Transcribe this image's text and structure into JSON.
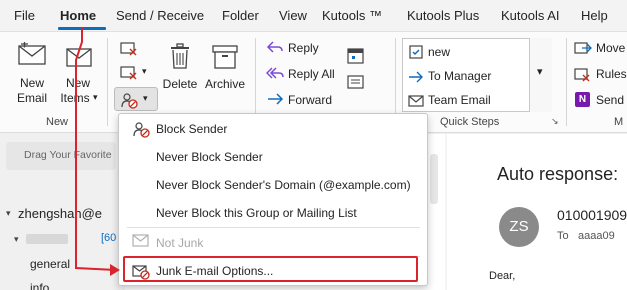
{
  "menubar": {
    "items": [
      "File",
      "Home",
      "Send / Receive",
      "Folder",
      "View",
      "Kutools ™",
      "Kutools Plus",
      "Kutools AI",
      "Help"
    ],
    "active": "Home"
  },
  "ribbon": {
    "new_group": {
      "new_email": [
        "New",
        "Email"
      ],
      "new_items": [
        "New",
        "Items"
      ],
      "label": "New"
    },
    "delete_group": {
      "delete": "Delete",
      "archive": "Archive"
    },
    "respond_group": {
      "reply": "Reply",
      "reply_all": "Reply All",
      "forward": "Forward"
    },
    "quick_steps": {
      "items": [
        "new",
        "To Manager",
        "Team Email"
      ],
      "label": "Quick Steps"
    },
    "move_group": {
      "items": [
        "Move",
        "Rules",
        "Send t"
      ],
      "label": "M"
    }
  },
  "left_pane": {
    "drag_hint": "Drag Your Favorite",
    "account": "zhengshan@e",
    "count": "[60",
    "folders": [
      "general",
      "info"
    ]
  },
  "reading_pane": {
    "subject": "Auto response:",
    "avatar_initials": "ZS",
    "sender": "010001909",
    "to_label": "To",
    "to_value": "aaaa09",
    "body": "Dear,"
  },
  "junk_menu": {
    "items": [
      {
        "label": "Block Sender",
        "icon": "block-sender-icon",
        "disabled": false
      },
      {
        "label": "Never Block Sender",
        "icon": "",
        "disabled": false
      },
      {
        "label": "Never Block Sender's Domain (@example.com)",
        "icon": "",
        "disabled": false
      },
      {
        "label": "Never Block this Group or Mailing List",
        "icon": "",
        "disabled": false
      },
      {
        "label": "Not Junk",
        "icon": "not-junk-icon",
        "disabled": true
      },
      {
        "label": "Junk E-mail Options...",
        "icon": "junk-options-icon",
        "disabled": false
      }
    ]
  },
  "colors": {
    "accent": "#0f6cbd",
    "highlight": "#d9232d",
    "avatar_bg": "#8a8a8a",
    "reply_purple": "#7b4bd6",
    "onenote": "#7719aa"
  }
}
